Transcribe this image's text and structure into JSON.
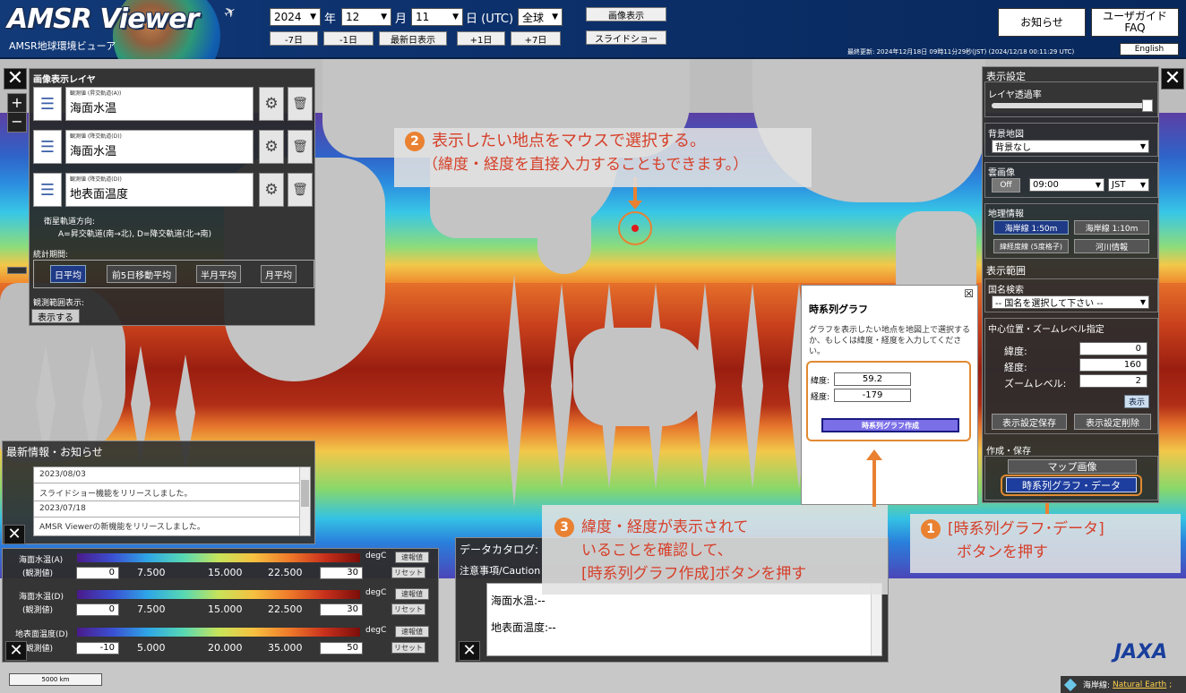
{
  "header": {
    "logo_text": "AMSR Viewer",
    "logo_subtitle": "AMSR地球環境ビューア",
    "year": "2024",
    "year_unit": "年",
    "month": "12",
    "month_unit": "月",
    "day": "11",
    "day_unit": "日 (UTC)",
    "region": "全球",
    "nav_buttons": [
      "-7日",
      "-1日",
      "最新日表示",
      "+1日",
      "+7日"
    ],
    "image_display_button": "画像表示",
    "slideshow_button": "スライドショー",
    "notice_button": "お知らせ",
    "guide_button_line1": "ユーザガイド",
    "guide_button_line2": "FAQ",
    "english_button": "English",
    "last_updated": "最終更新: 2024年12月18日 09時11分29秒(JST) (2024/12/18 00:11:29 UTC)"
  },
  "left_panel": {
    "title": "画像表示レイヤ",
    "layers": [
      {
        "small": "観測値 (昇交軌道(A))",
        "name": "海面水温"
      },
      {
        "small": "観測値 (降交軌道(D))",
        "name": "海面水温"
      },
      {
        "small": "観測値 (降交軌道(D))",
        "name": "地表面温度"
      }
    ],
    "orbit_title": "衛星軌道方向:",
    "orbit_desc": "A=昇交軌道(南→北), D=降交軌道(北→南)",
    "period_title": "統計期間:",
    "period_buttons": [
      "日平均",
      "前5日移動平均",
      "半月平均",
      "月平均"
    ],
    "obs_range_title": "観測範囲表示:",
    "obs_range_button": "表示する"
  },
  "zoom": {
    "plus": "+",
    "minus": "−"
  },
  "news": {
    "title": "最新情報・お知らせ",
    "items": [
      {
        "date": "2023/08/03",
        "text": "スライドショー機能をリリースしました。"
      },
      {
        "date": "2023/07/18",
        "text": "AMSR Viewerの新機能をリリースしました。"
      }
    ]
  },
  "colorbars": [
    {
      "label": "海面水温(A)",
      "sub": "(観測値)",
      "unit": "degC",
      "min": "0",
      "max": "30",
      "ticks": [
        "7.500",
        "15.000",
        "22.500"
      ],
      "btn1": "速報値",
      "btn2": "リセット"
    },
    {
      "label": "海面水温(D)",
      "sub": "(観測値)",
      "unit": "degC",
      "min": "0",
      "max": "30",
      "ticks": [
        "7.500",
        "15.000",
        "22.500"
      ],
      "btn1": "速報値",
      "btn2": "リセット"
    },
    {
      "label": "地表面温度(D)",
      "sub": "(観測値)",
      "unit": "degC",
      "min": "-10",
      "max": "50",
      "ticks": [
        "5.000",
        "20.000",
        "35.000"
      ],
      "btn1": "速報値",
      "btn2": "リセット"
    }
  ],
  "scale_label": "5000 km",
  "catalog": {
    "title": "データカタログ:",
    "caution": "注意事項/Caution",
    "sst": "海面水温:--",
    "lst": "地表面温度:--"
  },
  "timeseries_popup": {
    "title": "時系列グラフ",
    "close": "☒",
    "instruction": "グラフを表示したい地点を地図上で選択するか、もしくは緯度・経度を入力してください。",
    "lat_label": "緯度:",
    "lat_value": "59.2",
    "lon_label": "経度:",
    "lon_value": "-179",
    "create_button": "時系列グラフ作成"
  },
  "right_panel": {
    "title": "表示設定",
    "opacity_title": "レイヤ透過率",
    "basemap_title": "背景地図",
    "basemap_value": "背景なし",
    "cloud_title": "雲画像",
    "cloud_toggle": "Off",
    "cloud_time": "09:00",
    "cloud_tz": "JST",
    "geo_title": "地理情報",
    "geo_buttons": [
      "海岸線 1:50m",
      "海岸線 1:10m",
      "緯経度線 (5度格子)",
      "河川情報"
    ],
    "range_title": "表示範囲",
    "country_title": "国名検索",
    "country_value": "-- 国名を選択して下さい --",
    "center_title": "中心位置・ズームレベル指定",
    "lat_label": "緯度:",
    "lat_value": "0",
    "lon_label": "経度:",
    "lon_value": "160",
    "zoom_label": "ズームレベル:",
    "zoom_value": "2",
    "show_button": "表示",
    "save_button": "表示設定保存",
    "delete_button": "表示設定削除",
    "create_title": "作成・保存",
    "map_image_button": "マップ画像",
    "timeseries_button": "時系列グラフ・データ"
  },
  "annotations": {
    "step2_num": "2",
    "step2_line1": "表示したい地点をマウスで選択する。",
    "step2_line2": "（緯度・経度を直接入力することもできます。）",
    "step3_num": "3",
    "step3_line1": "緯度・経度が表示されて",
    "step3_line2": "いることを確認して、",
    "step3_line3": "[時系列グラフ作成]ボタンを押す",
    "step1_num": "1",
    "step1_line1": "[時系列グラフ･データ]",
    "step1_line2": "ボタンを押す"
  },
  "footer": {
    "jaxa_logo": "JAXA",
    "coastline_label": "海岸線:",
    "coastline_source": "Natural Earth",
    "coastline_suffix": ";"
  },
  "colors": {
    "accent_orange": "#e98131",
    "annotation_red": "#d6402a",
    "header_blue": "#0d326e"
  }
}
